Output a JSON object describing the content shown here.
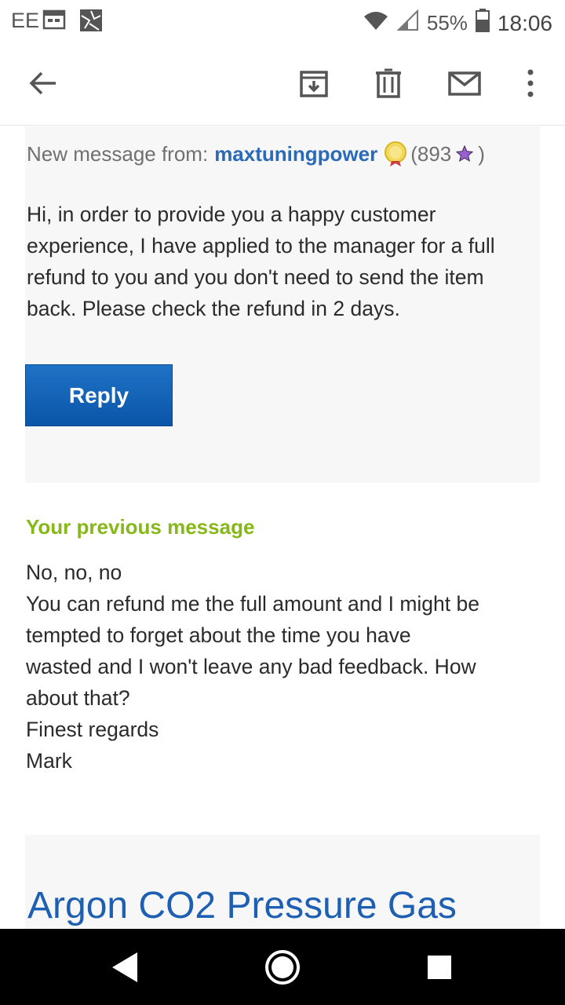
{
  "status_bar": {
    "carrier": "EE",
    "battery": "55%",
    "time": "18:06"
  },
  "toolbar": {
    "back_icon": "arrow-left-icon",
    "archive_icon": "archive-icon",
    "delete_icon": "trash-icon",
    "mail_icon": "envelope-icon",
    "more_icon": "more-vertical-icon"
  },
  "message": {
    "from_prefix": "New message from:",
    "sender": "maxtuningpower",
    "score_open": "(893",
    "score_close": ")",
    "body": "Hi, in order to provide you a happy customer experience, I have applied to the manager for a full refund to you and you don't need to send the item back. Please check the refund in 2 days.",
    "reply_label": "Reply"
  },
  "previous": {
    "title": "Your previous message",
    "lines": [
      "No, no, no",
      "You can refund me the full amount and I might be",
      "tempted to forget about the time you have",
      "wasted and  I won't leave any bad feedback. How",
      "about that?",
      "Finest regards",
      "Mark"
    ]
  },
  "item": {
    "title": "Argon CO2 Pressure Gas"
  },
  "colors": {
    "sender": "#2a6ab8",
    "previous_title": "#86b817",
    "reply_button": "#0a55a8",
    "item_title": "#1d5fb3"
  }
}
